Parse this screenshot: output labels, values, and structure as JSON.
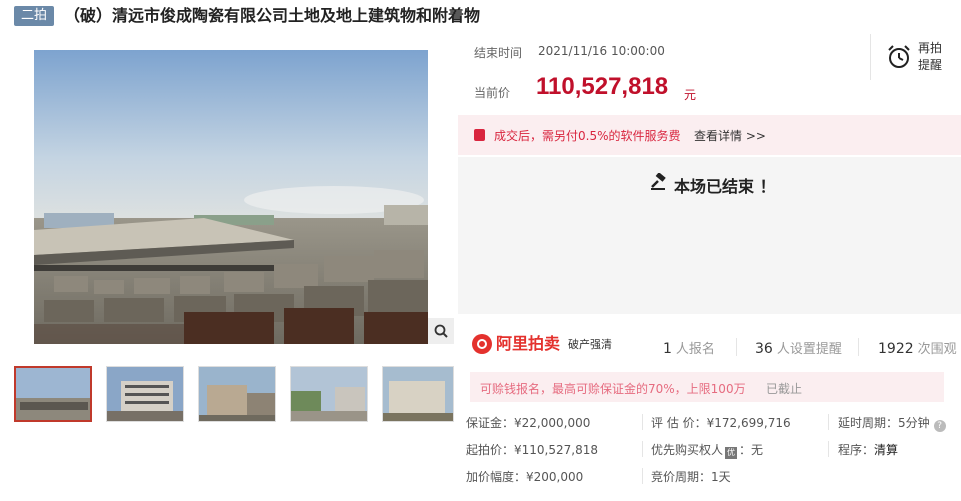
{
  "header": {
    "tag": "二拍",
    "title": "（破）清远市俊成陶瓷有限公司土地及地上建筑物和附着物"
  },
  "auction": {
    "end_time_label": "结束时间",
    "end_time": "2021/11/16 10:00:00",
    "price_label": "当前价",
    "price": "110,527,818",
    "price_unit": "元",
    "remind_label": "再拍提醒"
  },
  "fee_notice": {
    "text": "成交后，需另付0.5%的软件服务费",
    "link": "查看详情 >>"
  },
  "status": {
    "ended_text": "本场已结束 ！"
  },
  "platform": {
    "name": "阿里拍卖",
    "sub": "破产强清"
  },
  "stats": {
    "signup_count": "1",
    "signup_label": "人报名",
    "remind_count": "36",
    "remind_label": "人设置提醒",
    "view_count": "1922",
    "view_label": "次围观"
  },
  "deposit_notice": {
    "text": "可赊钱报名，最高可赊保证金的70%，上限100万",
    "status": "已截止"
  },
  "details": {
    "deposit": "保证金：¥22,000,000",
    "appraisal": "评 估 价：¥172,699,716",
    "delay": "延时周期：5分钟",
    "start_price": "起拍价：¥110,527,818",
    "priority_label": "优先购买权人",
    "priority_value": "：无",
    "procedure_label": "程序：",
    "procedure_value": "清算",
    "increment": "加价幅度：¥200,000",
    "cycle": "竞价周期：1天"
  },
  "icons": {
    "zoom": "magnifier-icon",
    "remind": "alarm-clock-icon",
    "gavel": "gavel-icon",
    "help": "help-icon",
    "fee": "bag-icon"
  },
  "colors": {
    "accent_red": "#c0102b",
    "tag_bg": "#6b89a8",
    "notice_bg": "#fbeef0"
  }
}
